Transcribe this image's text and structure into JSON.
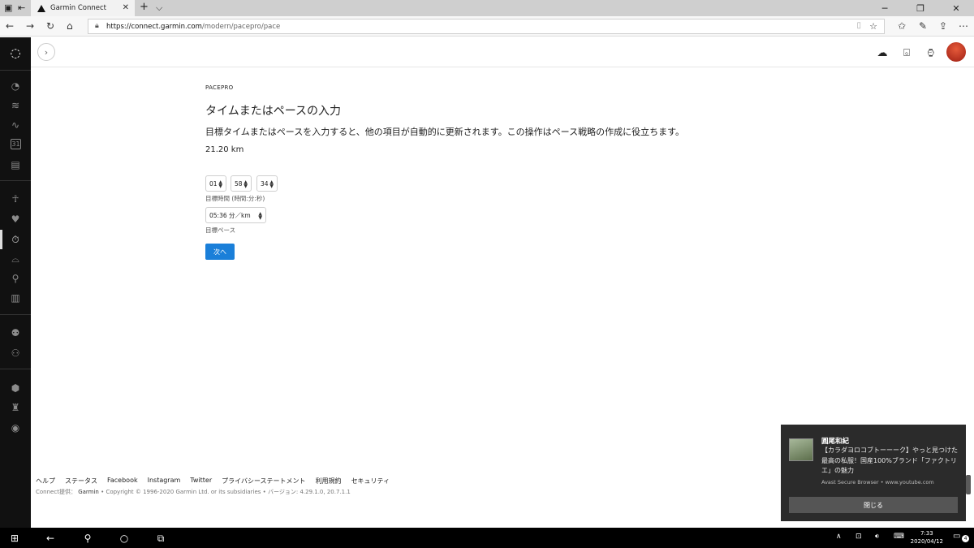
{
  "browser": {
    "tab_title": "Garmin Connect",
    "url_host": "https://connect.garmin.com",
    "url_path": "/modern/pacepro/pace",
    "new_tab": "+",
    "tab_menu": "⌵"
  },
  "sidebar": {
    "items": [
      {
        "icon": "dashboard-icon"
      },
      {
        "icon": "layers-icon"
      },
      {
        "icon": "activity-icon"
      },
      {
        "icon": "calendar-icon",
        "label": "31"
      },
      {
        "icon": "news-icon"
      },
      {
        "icon": "training-icon"
      },
      {
        "icon": "heart-icon"
      },
      {
        "icon": "stopwatch-icon",
        "active": true
      },
      {
        "icon": "shoe-icon"
      },
      {
        "icon": "insights-icon"
      },
      {
        "icon": "reports-icon"
      },
      {
        "icon": "connections-icon"
      },
      {
        "icon": "groups-icon"
      },
      {
        "icon": "badges-icon"
      },
      {
        "icon": "trophy-icon"
      },
      {
        "icon": "challenges-icon"
      }
    ]
  },
  "header": {
    "icons": [
      "upload-icon",
      "inbox-icon",
      "device-icon",
      "avatar"
    ]
  },
  "main": {
    "eyebrow": "PACEPRO",
    "title": "タイムまたはペースの入力",
    "description": "目標タイムまたはペースを入力すると、他の項目が自動的に更新されます。この操作はペース戦略の作成に役立ちます。",
    "distance": "21.20 km",
    "target_time": {
      "hours": "01",
      "minutes": "58",
      "seconds": "34",
      "label": "目標時間 (時間:分:秒)"
    },
    "target_pace": {
      "value": "05:36 分／km",
      "label": "目標ペース"
    },
    "next_button": "次へ"
  },
  "footer": {
    "links": [
      "ヘルプ",
      "ステータス",
      "Facebook",
      "Instagram",
      "Twitter",
      "プライバシーステートメント",
      "利用規約",
      "セキュリティ"
    ],
    "powered_prefix": "Connect提供：",
    "powered_brand": "Garmin",
    "copyright": " • Copyright © 1996-2020 Garmin Ltd. or its subsidiaries • バージョン: 4.29.1.0, 20.7.1.1"
  },
  "toast": {
    "sender": "圓尾和紀",
    "message": "【カラダヨロコブトーーーク】やっと見つけた最高の私服！国産100%ブランド「ファクトリエ」の魅力",
    "source": "Avast Secure Browser • www.youtube.com",
    "close_label": "閉じる"
  },
  "taskbar": {
    "time": "7:33",
    "date": "2020/04/12",
    "notification_count": "4"
  },
  "colors": {
    "accent": "#1a7fd9",
    "sidebar_bg": "#111111",
    "toast_bg": "#2b2b2b"
  }
}
